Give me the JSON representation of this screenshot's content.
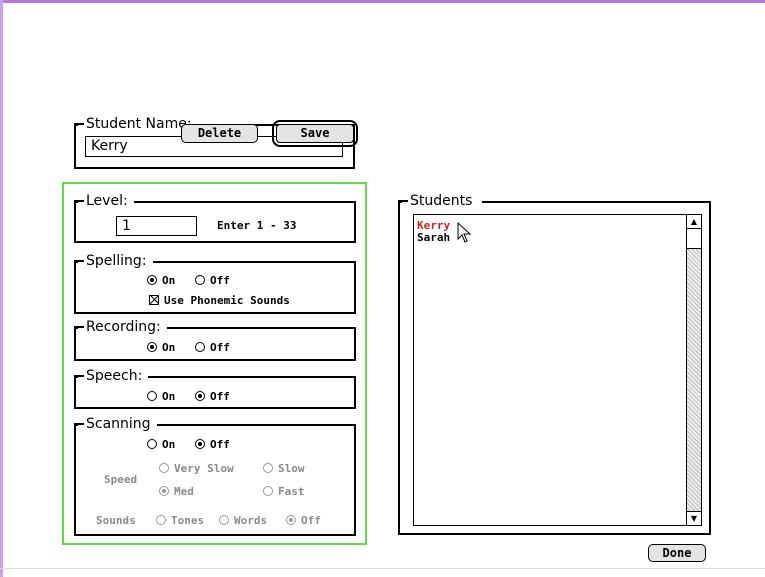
{
  "student_name": {
    "legend": "Student Name:",
    "value": "Kerry"
  },
  "buttons": {
    "delete": "Delete",
    "save": "Save",
    "done": "Done"
  },
  "level": {
    "legend": "Level:",
    "value": "1",
    "hint": "Enter 1 - 33"
  },
  "spelling": {
    "legend": "Spelling:",
    "on": "On",
    "off": "Off",
    "selected": "On",
    "phonemic_label": "Use Phonemic Sounds",
    "phonemic_checked": true
  },
  "recording": {
    "legend": "Recording:",
    "on": "On",
    "off": "Off",
    "selected": "On"
  },
  "speech": {
    "legend": "Speech:",
    "on": "On",
    "off": "Off",
    "selected": "Off"
  },
  "scanning": {
    "legend": "Scanning",
    "on": "On",
    "off": "Off",
    "selected": "Off",
    "speed_label": "Speed",
    "speed_options": [
      "Very Slow",
      "Slow",
      "Med",
      "Fast"
    ],
    "speed_selected": "Med",
    "sounds_label": "Sounds",
    "sounds_options": [
      "Tones",
      "Words",
      "Off"
    ],
    "sounds_selected": "Off"
  },
  "students": {
    "legend": "Students",
    "items": [
      "Kerry",
      "Sarah"
    ],
    "selected": "Kerry",
    "selected_color": "#cc1f1f"
  },
  "colors": {
    "panel_border": "#5fdc3f",
    "window_accent": "#b57be0"
  }
}
